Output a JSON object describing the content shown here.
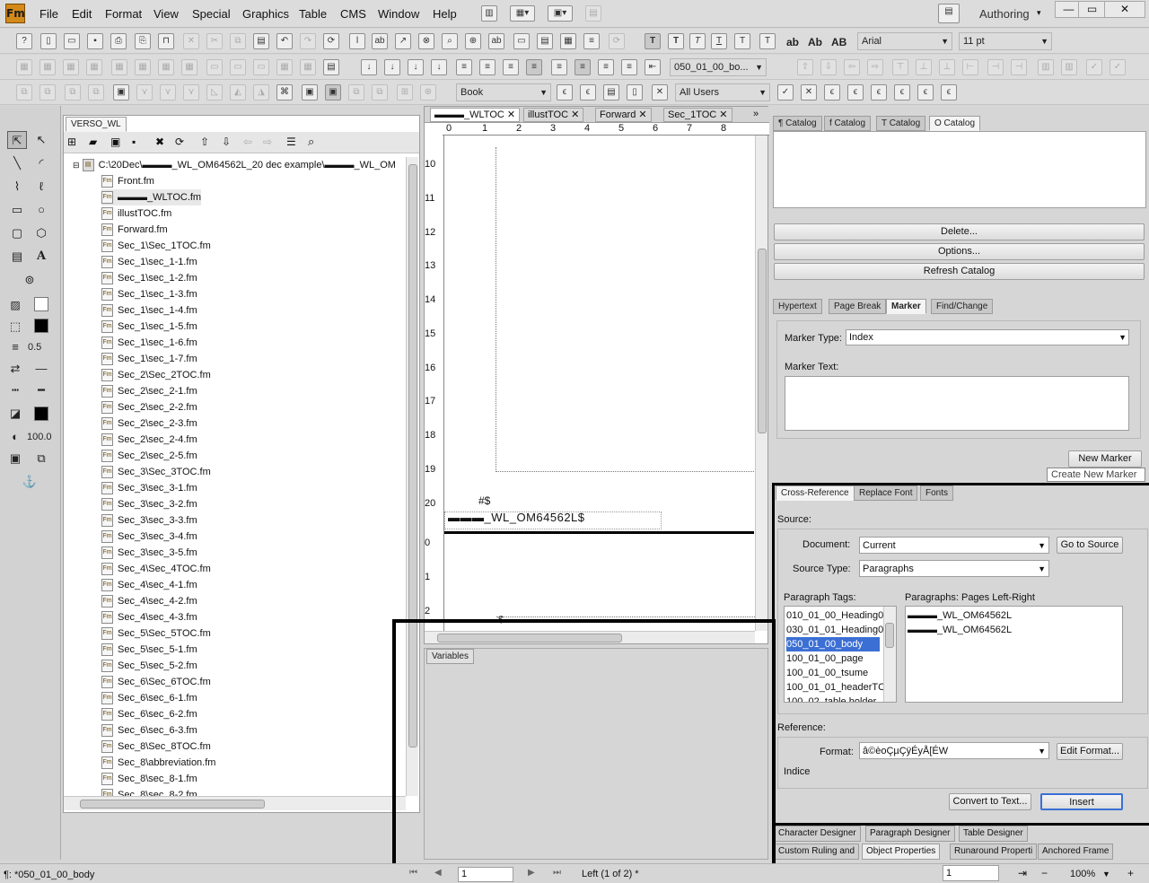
{
  "app": {
    "logo": "Fm",
    "workspace": "Authoring"
  },
  "menu": [
    "File",
    "Edit",
    "Format",
    "View",
    "Special",
    "Graphics",
    "Table",
    "CMS",
    "Window",
    "Help"
  ],
  "window_buttons": [
    "—",
    "▭",
    "✕"
  ],
  "toolbar": {
    "font": "Arial",
    "size": "11 pt",
    "para_tag": "050_01_00_bo...",
    "book": "Book",
    "users": "All Users",
    "text_btns": [
      "T",
      "T",
      "T",
      "T",
      "T",
      "T",
      "ab",
      "Ab",
      "AB"
    ]
  },
  "tools": {
    "line_width": "0.5",
    "tint": "100.0"
  },
  "book": {
    "tab": "VERSO_WL",
    "path": "C:\\20Dec\\▬▬▬_WL_OM64562L_20 dec example\\▬▬▬_WL_OM",
    "files": [
      "Front.fm",
      "▬▬▬_WLTOC.fm",
      "illustTOC.fm",
      "Forward.fm",
      "Sec_1\\Sec_1TOC.fm",
      "Sec_1\\sec_1-1.fm",
      "Sec_1\\sec_1-2.fm",
      "Sec_1\\sec_1-3.fm",
      "Sec_1\\sec_1-4.fm",
      "Sec_1\\sec_1-5.fm",
      "Sec_1\\sec_1-6.fm",
      "Sec_1\\sec_1-7.fm",
      "Sec_2\\Sec_2TOC.fm",
      "Sec_2\\sec_2-1.fm",
      "Sec_2\\sec_2-2.fm",
      "Sec_2\\sec_2-3.fm",
      "Sec_2\\sec_2-4.fm",
      "Sec_2\\sec_2-5.fm",
      "Sec_3\\Sec_3TOC.fm",
      "Sec_3\\sec_3-1.fm",
      "Sec_3\\sec_3-2.fm",
      "Sec_3\\sec_3-3.fm",
      "Sec_3\\sec_3-4.fm",
      "Sec_3\\sec_3-5.fm",
      "Sec_4\\Sec_4TOC.fm",
      "Sec_4\\sec_4-1.fm",
      "Sec_4\\sec_4-2.fm",
      "Sec_4\\sec_4-3.fm",
      "Sec_5\\Sec_5TOC.fm",
      "Sec_5\\sec_5-1.fm",
      "Sec_5\\sec_5-2.fm",
      "Sec_6\\Sec_6TOC.fm",
      "Sec_6\\sec_6-1.fm",
      "Sec_6\\sec_6-2.fm",
      "Sec_6\\sec_6-3.fm",
      "Sec_8\\Sec_8TOC.fm",
      "Sec_8\\abbreviation.fm",
      "Sec_8\\sec_8-1.fm",
      "Sec_8\\sec_8-2.fm"
    ]
  },
  "doc": {
    "tabs": [
      "▬▬▬_WLTOC",
      "illustTOC",
      "Forward",
      "Sec_1TOC"
    ],
    "ruler": [
      "0",
      "1",
      "2",
      "3",
      "4",
      "5",
      "6",
      "7",
      "8"
    ],
    "vruler": [
      "10",
      "11",
      "12",
      "13",
      "14",
      "15",
      "16",
      "17",
      "18",
      "19",
      "20",
      "0",
      "1",
      "2"
    ],
    "marker_sym": "#$",
    "footer_text": "▬▬▬_WL_OM64562L$",
    "small_sym": "$"
  },
  "variables": {
    "tab": "Variables"
  },
  "catalogs": {
    "tabs": [
      "¶ Catalog",
      "f Catalog",
      "T Catalog",
      "O Catalog"
    ],
    "delete": "Delete...",
    "options": "Options...",
    "refresh": "Refresh Catalog"
  },
  "marker": {
    "tabs": [
      "Hypertext",
      "Page Break",
      "Marker",
      "Find/Change"
    ],
    "type_label": "Marker Type:",
    "type_value": "Index",
    "text_label": "Marker Text:",
    "new_marker": "New Marker",
    "tooltip": "Create New Marker"
  },
  "xref": {
    "tabs": [
      "Cross-Reference",
      "Replace Font",
      "Fonts"
    ],
    "source": "Source:",
    "document_label": "Document:",
    "document_value": "Current",
    "goto_source": "Go to Source",
    "source_type_label": "Source Type:",
    "source_type_value": "Paragraphs",
    "tags_label": "Paragraph Tags:",
    "pages_label": "Paragraphs: Pages  Left-Right",
    "tags": [
      "010_01_00_Heading0",
      "030_01_01_Heading0",
      "050_01_00_body",
      "100_01_00_page",
      "100_01_00_tsume",
      "100_01_01_headerTC",
      "100_02_table holder"
    ],
    "paragraphs": [
      "▬▬▬_WL_OM64562L",
      "▬▬▬_WL_OM64562L"
    ],
    "reference": "Reference:",
    "format_label": "Format:",
    "format_value": "â©èoÇµÇÿÉyÅ[ÉW",
    "edit_format": "Edit Format...",
    "indice": "Indice",
    "convert": "Convert to Text...",
    "insert": "Insert"
  },
  "bottom_tabs": {
    "row1": [
      "Character Designer",
      "Paragraph Designer",
      "Table Designer"
    ],
    "row2": [
      "Custom Ruling and",
      "Object Properties",
      "Runaround Properti",
      "Anchored Frame"
    ]
  },
  "status": {
    "tag": "¶: *050_01_00_body",
    "page": "1",
    "page_info": "Left (1 of 2) *",
    "page_right": "1",
    "zoom": "100%"
  }
}
